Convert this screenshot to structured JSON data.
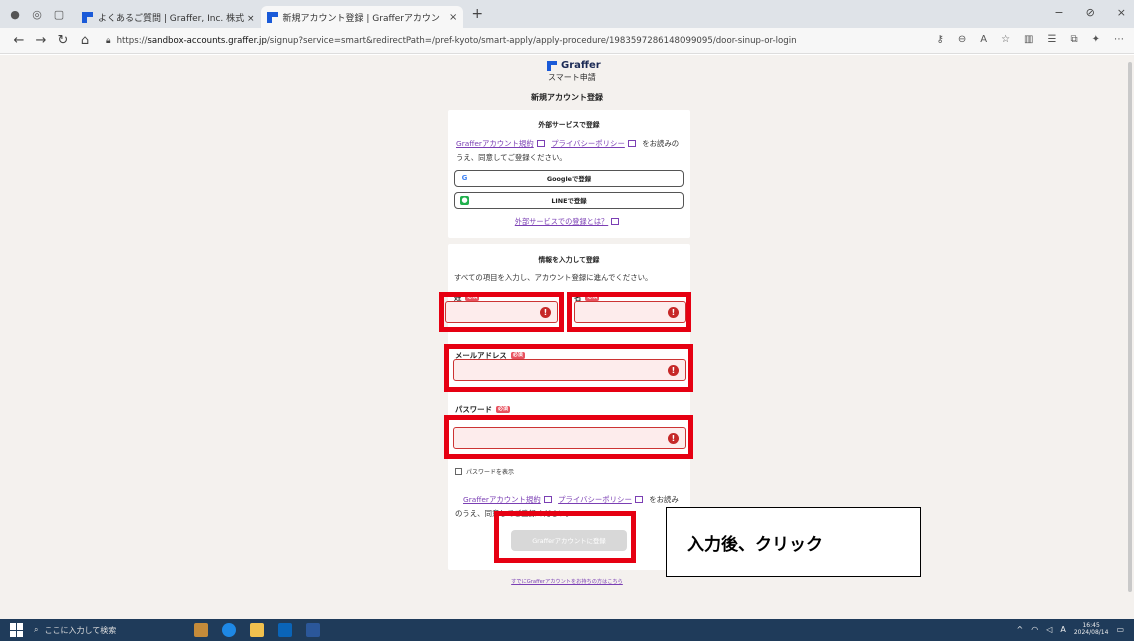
{
  "browser": {
    "tabs": [
      {
        "label": "よくあるご質問 | Graffer, Inc. 株式 ×",
        "close": ""
      },
      {
        "label": "新規アカウント登録 | Grafferアカウン",
        "close": "×"
      }
    ],
    "new_tab": "+",
    "window_controls": [
      "−",
      "⊘",
      "×"
    ],
    "url_prefix": "https://",
    "url_host": "sandbox-accounts.graffer.jp",
    "url_path": "/signup?service=smart&redirectPath=/pref-kyoto/smart-apply/apply-procedure/1983597286148099095/door-sinup-or-login"
  },
  "brand": {
    "name": "Graffer",
    "sub": "スマート申請"
  },
  "page_title": "新規アカウント登録",
  "external_section": {
    "title": "外部サービスで登録",
    "terms_link": "Grafferアカウント規約",
    "privacy_link": "プライバシーポリシー",
    "agree_suffix": "をお読みの",
    "agree_line2": "うえ、同意してご登録ください。",
    "google_button": "Googleで登録",
    "line_button": "LINEで登録",
    "what_link": "外部サービスでの登録とは？"
  },
  "manual_section": {
    "title": "情報を入力して登録",
    "description": "すべての項目を入力し、アカウント登録に進んでください。",
    "last_name_label": "姓",
    "first_name_label": "名",
    "email_label": "メールアドレス",
    "password_label": "パスワード",
    "required_badge": "必須",
    "show_password": "パスワードを表示",
    "terms_link": "Grafferアカウント規約",
    "privacy_link": "プライバシーポリシー",
    "agree_suffix": "をお読み",
    "agree_line2": "のうえ、同意してご登録ください。",
    "submit_button": "Grafferアカウントに登録"
  },
  "existing_account_link": "すでにGrafferアカウントをお持ちの方はこちら",
  "annotation": {
    "callout_text": "入力後、クリック",
    "highlight_color": "#e60012"
  },
  "taskbar": {
    "search_placeholder": "ここに入力して検索",
    "time": "16:45",
    "date": "2024/08/14"
  }
}
